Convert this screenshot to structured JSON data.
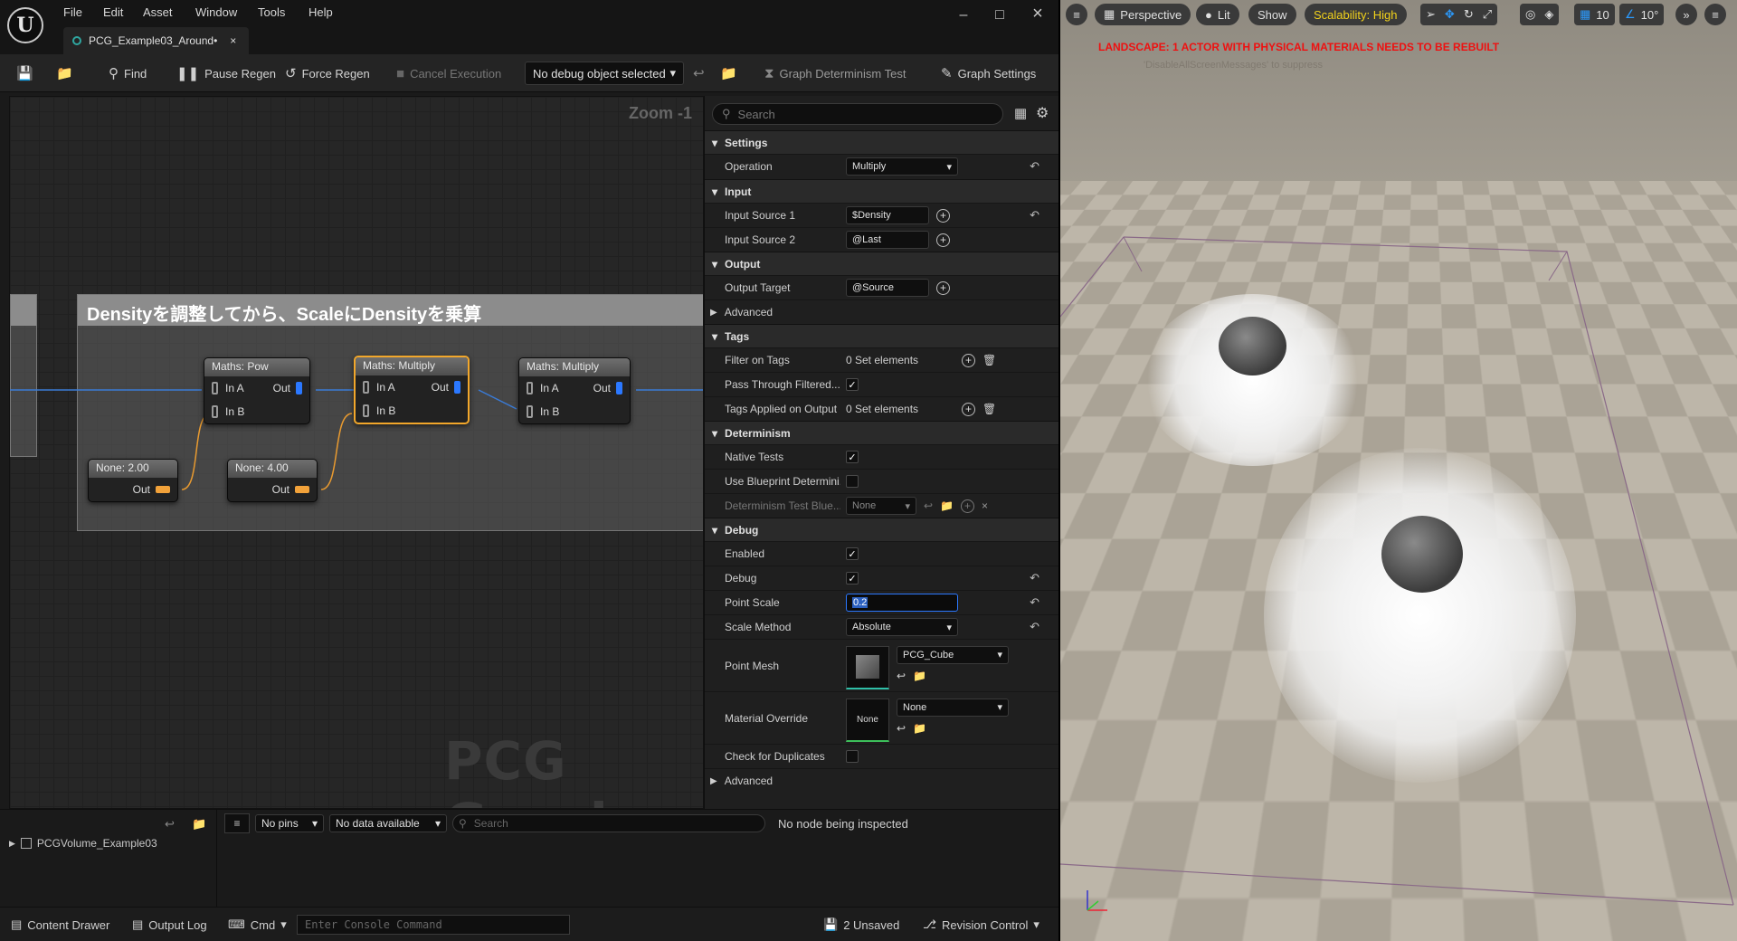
{
  "menu": [
    "File",
    "Edit",
    "Asset",
    "Window",
    "Tools",
    "Help"
  ],
  "document_tab": "PCG_Example03_Around•",
  "toolbar": {
    "find": "Find",
    "pause_regen": "Pause Regen",
    "force_regen": "Force Regen",
    "cancel_execution": "Cancel Execution",
    "debug_object": "No debug object selected",
    "determinism_test": "Graph Determinism Test",
    "graph_settings": "Graph Settings"
  },
  "graph": {
    "zoom": "Zoom -1",
    "watermark": "PCG Graph",
    "comment": "Densityを調整してから、ScaleにDensityを乗算",
    "nodes": [
      {
        "title": "Maths: Pow",
        "in_a": "In A",
        "in_b": "In B",
        "out": "Out"
      },
      {
        "title": "Maths: Multiply",
        "in_a": "In A",
        "in_b": "In B",
        "out": "Out"
      },
      {
        "title": "Maths: Multiply",
        "in_a": "In A",
        "in_b": "In B",
        "out": "Out"
      }
    ],
    "constants": [
      {
        "title": "None: 2.00",
        "out": "Out"
      },
      {
        "title": "None: 4.00",
        "out": "Out"
      }
    ]
  },
  "details": {
    "search_placeholder": "Search",
    "settings": {
      "header": "Settings",
      "operation_label": "Operation",
      "operation_value": "Multiply"
    },
    "input": {
      "header": "Input",
      "source1_label": "Input Source 1",
      "source1_value": "$Density",
      "source2_label": "Input Source 2",
      "source2_value": "@Last"
    },
    "output": {
      "header": "Output",
      "target_label": "Output Target",
      "target_value": "@Source"
    },
    "advanced1": "Advanced",
    "tags": {
      "header": "Tags",
      "filter_label": "Filter on Tags",
      "filter_value": "0 Set elements",
      "pass_label": "Pass Through Filtered...",
      "applied_label": "Tags Applied on Output",
      "applied_value": "0 Set elements"
    },
    "determinism": {
      "header": "Determinism",
      "native_label": "Native Tests",
      "blueprint_label": "Use Blueprint Determini...",
      "test_blue_label": "Determinism Test Blue...",
      "test_blue_value": "None"
    },
    "debug": {
      "header": "Debug",
      "enabled_label": "Enabled",
      "debug_label": "Debug",
      "point_scale_label": "Point Scale",
      "point_scale_value": "0.2",
      "scale_method_label": "Scale Method",
      "scale_method_value": "Absolute",
      "point_mesh_label": "Point Mesh",
      "point_mesh_value": "PCG_Cube",
      "material_label": "Material Override",
      "material_value": "None",
      "material_thumb": "None",
      "duplicates_label": "Check for Duplicates"
    },
    "advanced2": "Advanced"
  },
  "bottom": {
    "tree_item": "PCGVolume_Example03",
    "no_pins": "No pins",
    "no_data": "No data available",
    "search_placeholder": "Search",
    "inspect_status": "No node being inspected"
  },
  "statusbar": {
    "content_drawer": "Content Drawer",
    "output_log": "Output Log",
    "cmd": "Cmd",
    "console_placeholder": "Enter Console Command",
    "unsaved": "2 Unsaved",
    "revision_control": "Revision Control"
  },
  "viewport": {
    "perspective": "Perspective",
    "lit": "Lit",
    "show": "Show",
    "scalability": "Scalability: High",
    "grid_value": "10",
    "angle_value": "10°",
    "warning": "LANDSCAPE: 1 ACTOR WITH PHYSICAL MATERIALS NEEDS TO BE REBUILT",
    "warning_sub": "'DisableAllScreenMessages' to suppress"
  },
  "colors": {
    "accent_selected": "#f2a72b",
    "pin_blue": "#2b78ff",
    "pin_orange": "#f2a23a",
    "warning_red": "#e11111",
    "scalability_yellow": "#f2d21b"
  }
}
